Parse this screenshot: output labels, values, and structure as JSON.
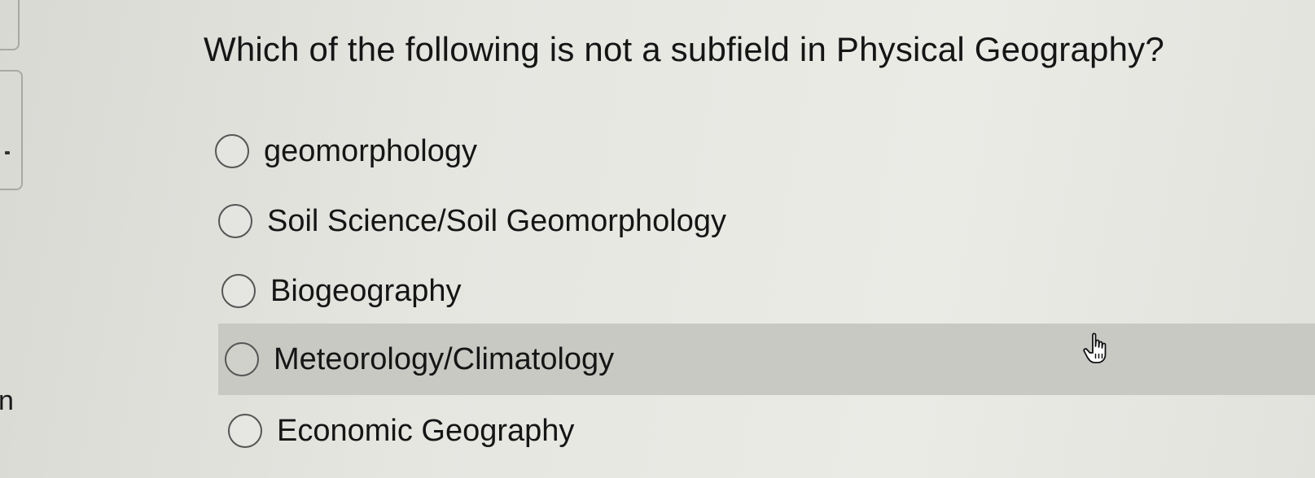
{
  "question": {
    "text": "Which of the following is not a subfield in Physical Geography?"
  },
  "options": [
    {
      "label": "geomorphology",
      "selected": false
    },
    {
      "label": "Soil Science/Soil Geomorphology",
      "selected": false
    },
    {
      "label": "Biogeography",
      "selected": false
    },
    {
      "label": "Meteorology/Climatology",
      "selected": false,
      "hovered": true
    },
    {
      "label": "Economic Geography",
      "selected": false
    }
  ],
  "left_panel": {
    "partial_text": "n"
  },
  "icons": {
    "cursor": "hand-pointer-icon"
  },
  "colors": {
    "hover_row": "#c9c9c4",
    "background": "#e6e6e1",
    "text": "#151515"
  }
}
